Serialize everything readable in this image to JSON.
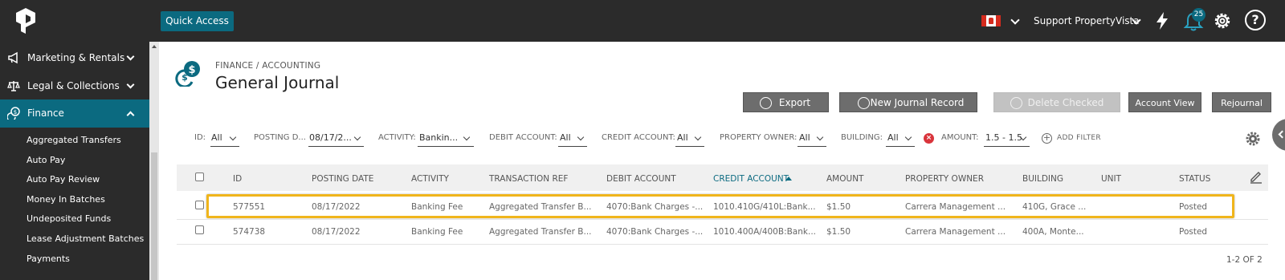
{
  "topbar": {
    "quick_access": "Quick Access",
    "user": "Support PropertyVista",
    "notification_count": "25",
    "help": "?"
  },
  "sidebar": {
    "items": [
      {
        "label": "Marketing & Rentals",
        "icon": "megaphone-icon"
      },
      {
        "label": "Legal & Collections",
        "icon": "scales-icon"
      },
      {
        "label": "Finance",
        "icon": "finance-icon",
        "active": true
      }
    ],
    "sub_items": [
      "Aggregated Transfers",
      "Auto Pay",
      "Auto Pay Review",
      "Money In Batches",
      "Undeposited Funds",
      "Lease Adjustment Batches",
      "Payments"
    ]
  },
  "page": {
    "breadcrumb": "FINANCE / ACCOUNTING",
    "title": "General Journal"
  },
  "actions": {
    "export": "Export",
    "new_record": "New Journal Record",
    "delete_checked": "Delete Checked",
    "account_view": "Account View",
    "rejournal": "Rejournal"
  },
  "filters": {
    "id": {
      "label": "ID:",
      "value": "All"
    },
    "posting": {
      "label": "POSTING D...",
      "value": "08/17/2..."
    },
    "activity": {
      "label": "ACTIVITY:",
      "value": "Bankin..."
    },
    "debit": {
      "label": "DEBIT ACCOUNT:",
      "value": "All"
    },
    "credit": {
      "label": "CREDIT ACCOUNT:",
      "value": "All"
    },
    "owner": {
      "label": "PROPERTY OWNER:",
      "value": "All"
    },
    "building": {
      "label": "BUILDING:",
      "value": "All"
    },
    "amount": {
      "label": "AMOUNT:",
      "value": "1.5 - 1.5"
    },
    "remove_symbol": "×",
    "add_filter_symbol": "+",
    "add_filter": "ADD FILTER"
  },
  "table": {
    "columns": [
      "ID",
      "POSTING DATE",
      "ACTIVITY",
      "TRANSACTION REF",
      "DEBIT ACCOUNT",
      "CREDIT ACCOUNT",
      "AMOUNT",
      "PROPERTY OWNER",
      "BUILDING",
      "UNIT",
      "STATUS"
    ],
    "rows": [
      [
        "577551",
        "08/17/2022",
        "Banking Fee",
        "Aggregated Transfer B...",
        "4070:Bank Charges -...",
        "1010.410G/410L:Bank...",
        "$1.50",
        "Carrera Management ...",
        "410G, Grace ...",
        "",
        "Posted"
      ],
      [
        "574738",
        "08/17/2022",
        "Banking Fee",
        "Aggregated Transfer B...",
        "4070:Bank Charges -...",
        "1010.400A/400B:Bank...",
        "$1.50",
        "Carrera Management ...",
        "400A, Monte...",
        "",
        "Posted"
      ]
    ],
    "pagination": "1-2 OF 2"
  },
  "colors": {
    "topbar": "#2b2b2b",
    "accent": "#0b6a80",
    "highlight": "#f0b51c",
    "danger": "#d9343b"
  }
}
